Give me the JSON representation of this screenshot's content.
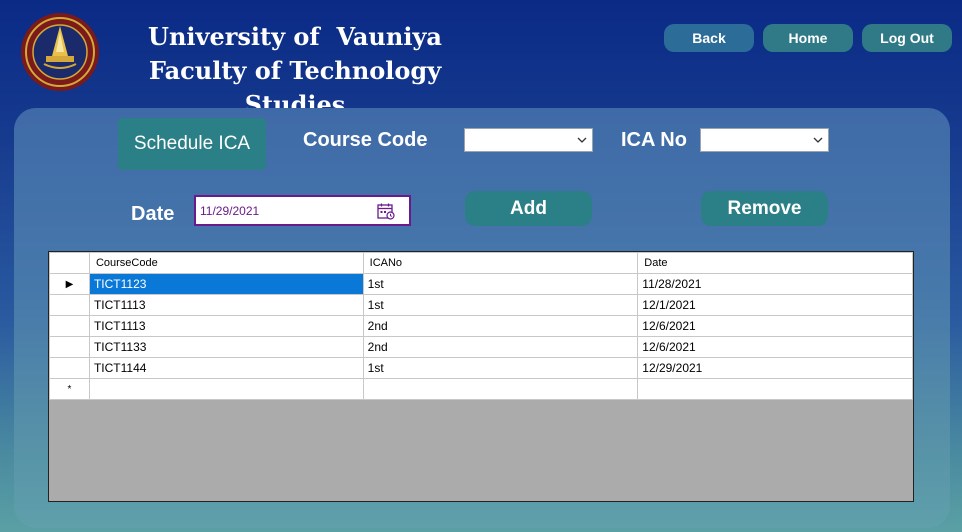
{
  "header": {
    "title_line1": "University of  Vauniya",
    "title_line2": "Faculty of Technology Studies",
    "buttons": {
      "back": "Back",
      "home": "Home",
      "logout": "Log Out"
    }
  },
  "form": {
    "schedule_label": "Schedule ICA",
    "course_code_label": "Course Code",
    "course_code_value": "",
    "ica_no_label": "ICA No",
    "ica_no_value": "",
    "date_label": "Date",
    "date_value": "11/29/2021",
    "add_label": "Add",
    "remove_label": "Remove"
  },
  "grid": {
    "columns": [
      "CourseCode",
      "ICANo",
      "Date"
    ],
    "rows": [
      [
        "TICT1123",
        "1st",
        "11/28/2021"
      ],
      [
        "TICT1113",
        "1st",
        "12/1/2021"
      ],
      [
        "TICT1113",
        "2nd",
        "12/6/2021"
      ],
      [
        "TICT1133",
        "2nd",
        "12/6/2021"
      ],
      [
        "TICT1144",
        "1st",
        "12/29/2021"
      ]
    ],
    "selected_row": 0,
    "new_row_marker": "*",
    "current_row_marker": "▶"
  }
}
